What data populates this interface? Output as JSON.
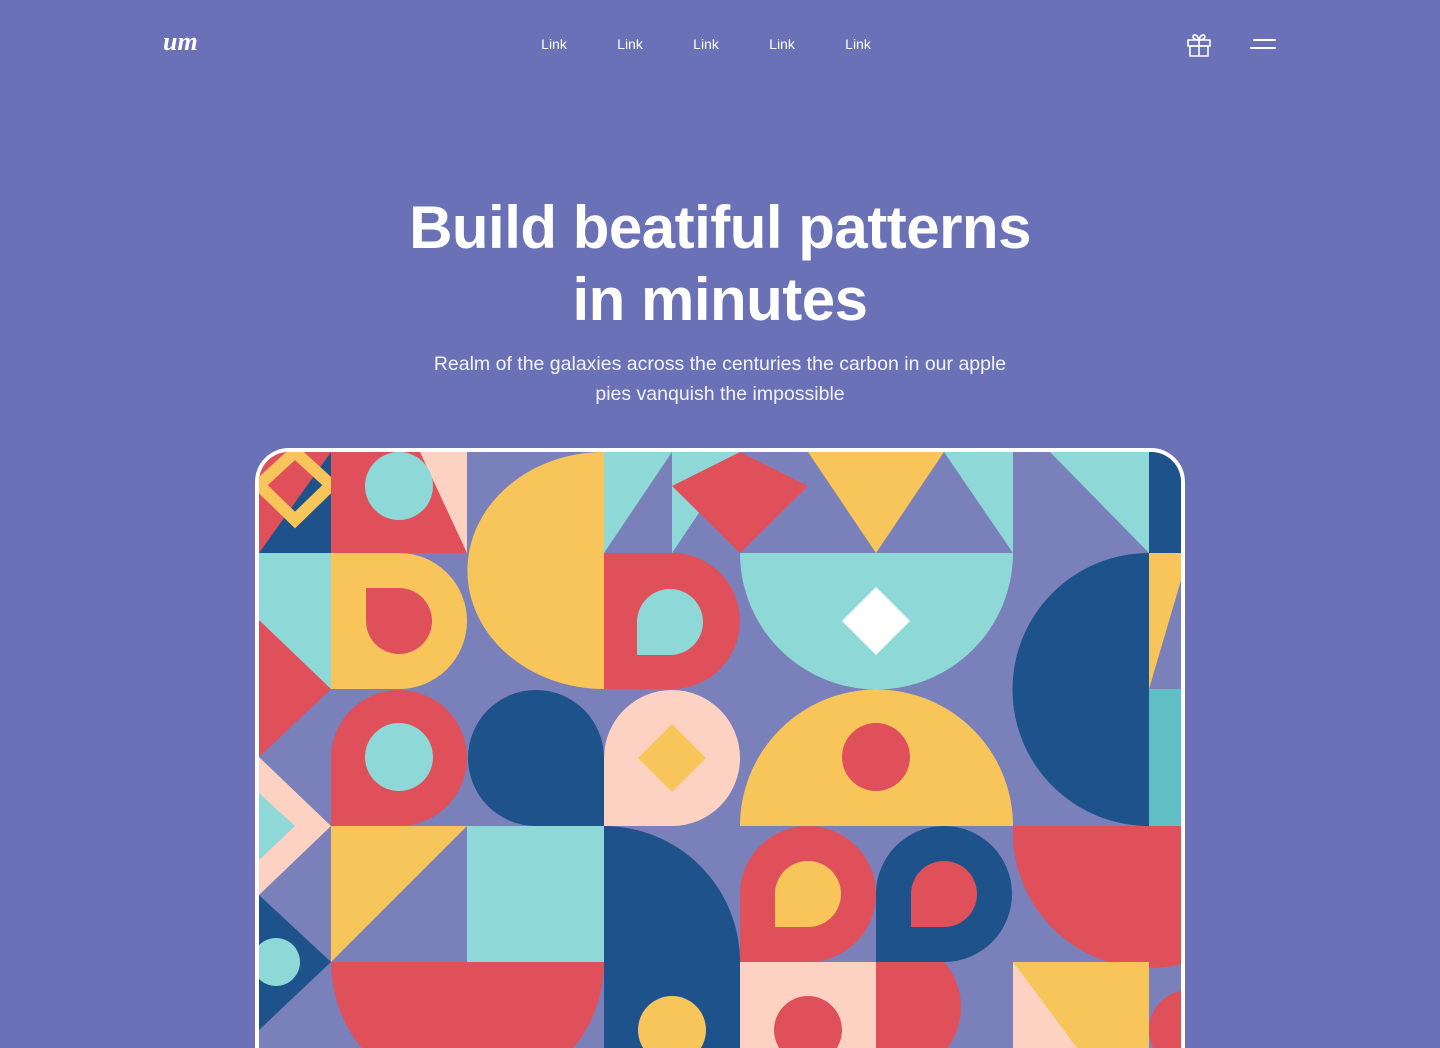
{
  "nav": {
    "logo_text": "um",
    "links": [
      "Link",
      "Link",
      "Link",
      "Link",
      "Link"
    ],
    "gift_icon": "gift-icon",
    "menu_icon": "menu-icon"
  },
  "hero": {
    "title_line1": "Build beatiful patterns",
    "title_line2": "in minutes",
    "subtitle_line1": "Realm of the galaxies across the centuries the carbon in our apple",
    "subtitle_line2": "pies vanquish the impossible"
  },
  "colors": {
    "background": "#6a71b6",
    "pattern_bg": "#7a80ba",
    "red": "#e0505b",
    "yellow": "#f8c55a",
    "teal": "#8fd8d8",
    "navy": "#1e528a",
    "peach": "#fdd2c3",
    "white": "#ffffff"
  }
}
